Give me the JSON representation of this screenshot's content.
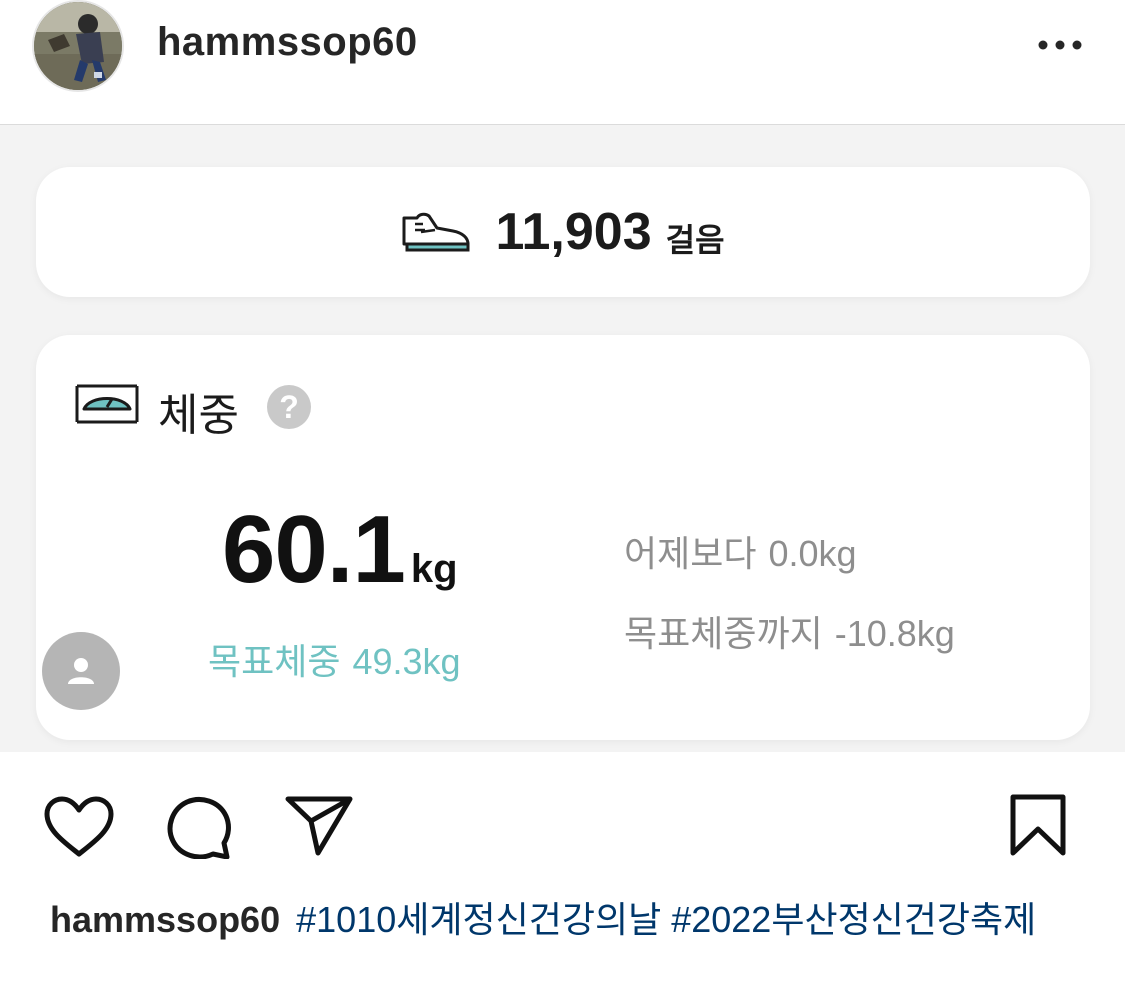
{
  "post": {
    "username": "hammssop60",
    "avatar_icon": "profile-photo"
  },
  "header": {
    "more_icon": "more-horizontal-icon"
  },
  "health_card": {
    "steps": {
      "icon": "sneaker-icon",
      "value": "11,903",
      "unit": "걸음"
    },
    "weight": {
      "icon": "scale-icon",
      "title": "체중",
      "help_icon": "help-icon",
      "help_symbol": "?",
      "value": "60.1",
      "unit": "kg",
      "goal_label": "목표체중",
      "goal_value": "49.3kg",
      "vs_yesterday_label": "어제보다",
      "vs_yesterday_value": "0.0kg",
      "to_goal_label": "목표체중까지",
      "to_goal_value": "-10.8kg"
    },
    "colors": {
      "accent_teal": "#6fc2c2",
      "card_bg": "#ffffff",
      "panel_bg": "#f3f3f3",
      "muted_text": "#8e8e8e"
    }
  },
  "actions": {
    "like_icon": "heart-icon",
    "comment_icon": "comment-icon",
    "share_icon": "send-icon",
    "save_icon": "bookmark-icon"
  },
  "caption": {
    "username": "hammssop60",
    "hashtag1": "#1010세계정신건강의날",
    "hashtag2": "#2022부산정신건강축제"
  }
}
